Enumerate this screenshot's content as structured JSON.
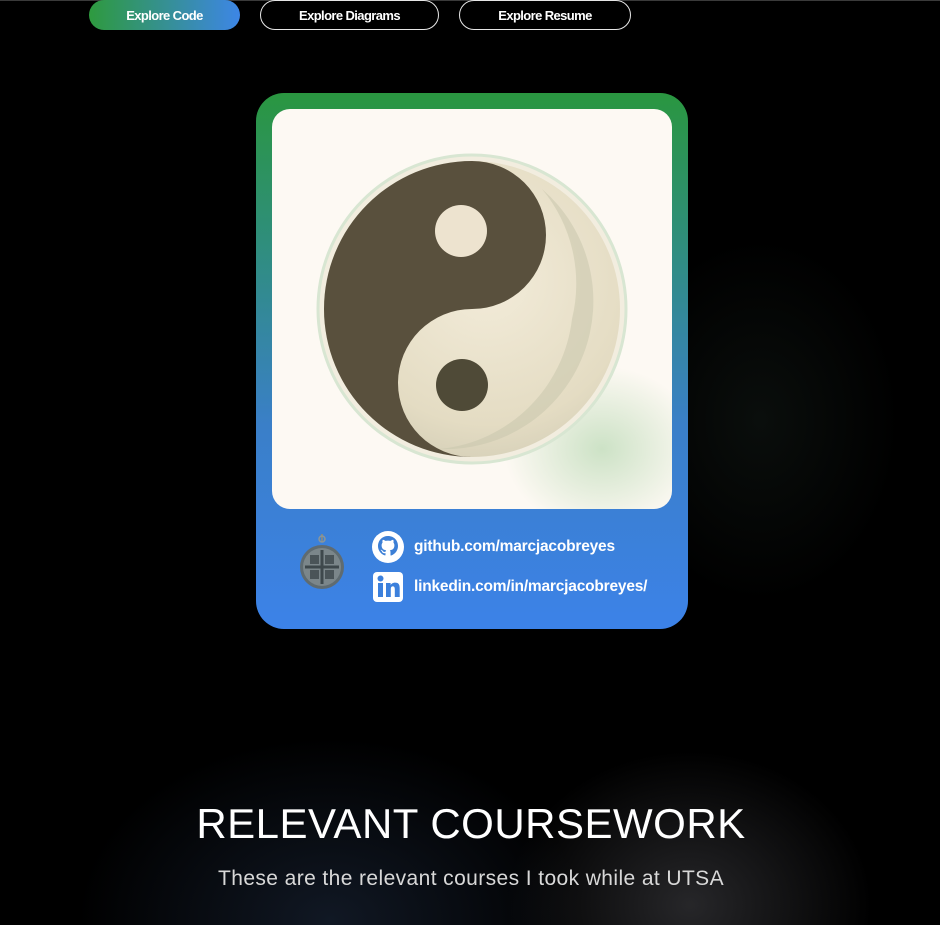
{
  "nav": {
    "explore_code": "Explore Code",
    "explore_diagrams": "Explore Diagrams",
    "explore_resume": "Explore Resume"
  },
  "profile_card": {
    "image_icon": "yin-yang-icon",
    "coin_icon": "coin-pendant-icon",
    "github": {
      "icon": "github-icon",
      "label": "github.com/marcjacobreyes"
    },
    "linkedin": {
      "icon": "linkedin-icon",
      "label": "linkedin.com/in/marcjacobreyes/"
    }
  },
  "coursework": {
    "title": "RELEVANT COURSEWORK",
    "subtitle": "These are the relevant courses I took while at UTSA"
  },
  "colors": {
    "accent_green": "#2a9640",
    "accent_blue": "#3c82e8",
    "background": "#000000"
  }
}
